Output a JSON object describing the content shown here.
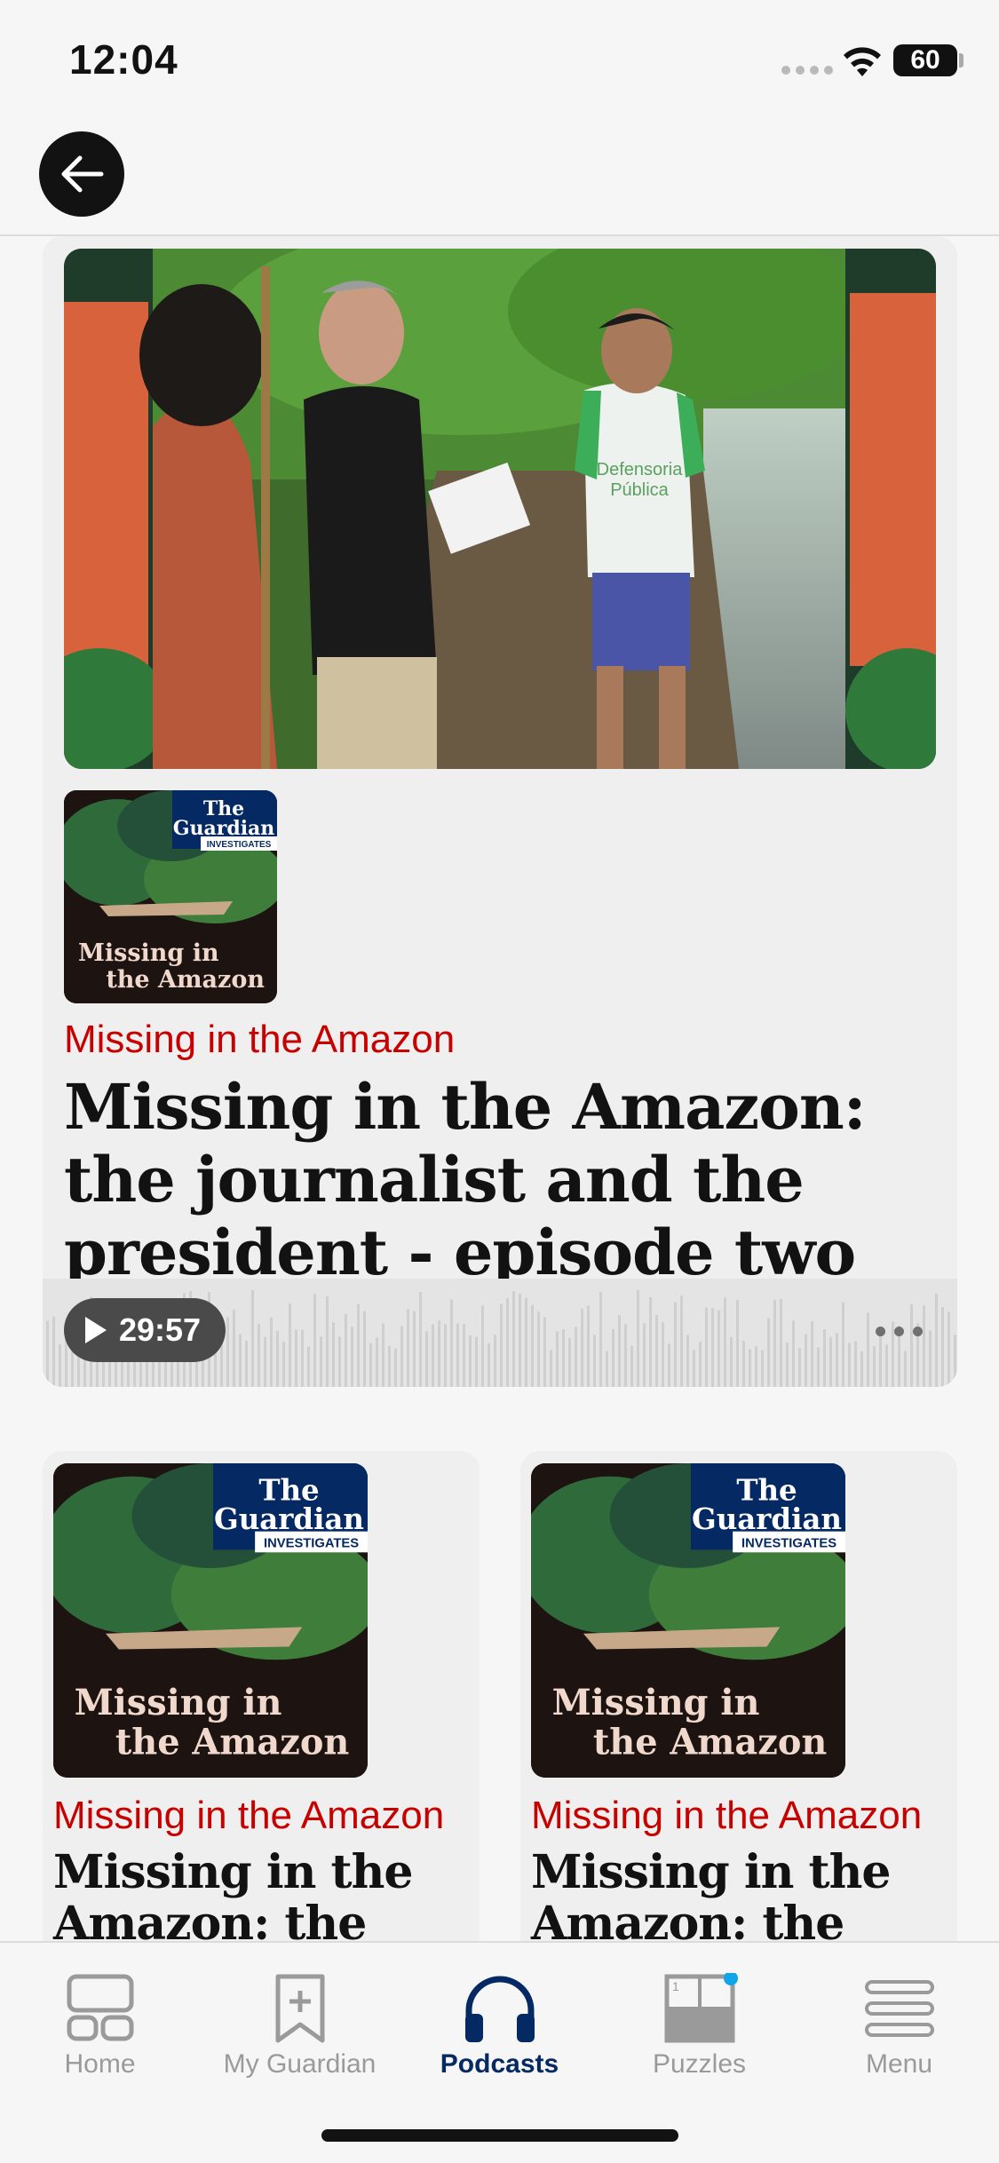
{
  "status_bar": {
    "time": "12:04",
    "battery": "60"
  },
  "header": {
    "back_icon": "arrow-left-icon"
  },
  "featured": {
    "series": "Missing in the Amazon",
    "title": "Missing in the Amazon: the journalist and the president - episode two",
    "duration": "29:57",
    "cover": {
      "brand_line1": "The",
      "brand_line2": "Guardian",
      "brand_tag": "INVESTIGATES",
      "cover_title_line1": "Missing in",
      "cover_title_line2": "the Amazon"
    },
    "hero_sign_text": [
      "Defensoria",
      "Pública"
    ]
  },
  "episodes": [
    {
      "series": "Missing in the Amazon",
      "title": "Missing in the Amazon: the"
    },
    {
      "series": "Missing in the Amazon",
      "title": "Missing in the Amazon: the"
    }
  ],
  "tabs": [
    {
      "label": "Home",
      "icon": "home-icon",
      "active": false
    },
    {
      "label": "My Guardian",
      "icon": "bookmark-add-icon",
      "active": false
    },
    {
      "label": "Podcasts",
      "icon": "headphones-icon",
      "active": true
    },
    {
      "label": "Puzzles",
      "icon": "crossword-icon",
      "active": false,
      "badge": true
    },
    {
      "label": "Menu",
      "icon": "menu-icon",
      "active": false
    }
  ],
  "colors": {
    "accent_red": "#c70000",
    "brand_blue": "#052962",
    "badge_blue": "#0ea5e9"
  }
}
